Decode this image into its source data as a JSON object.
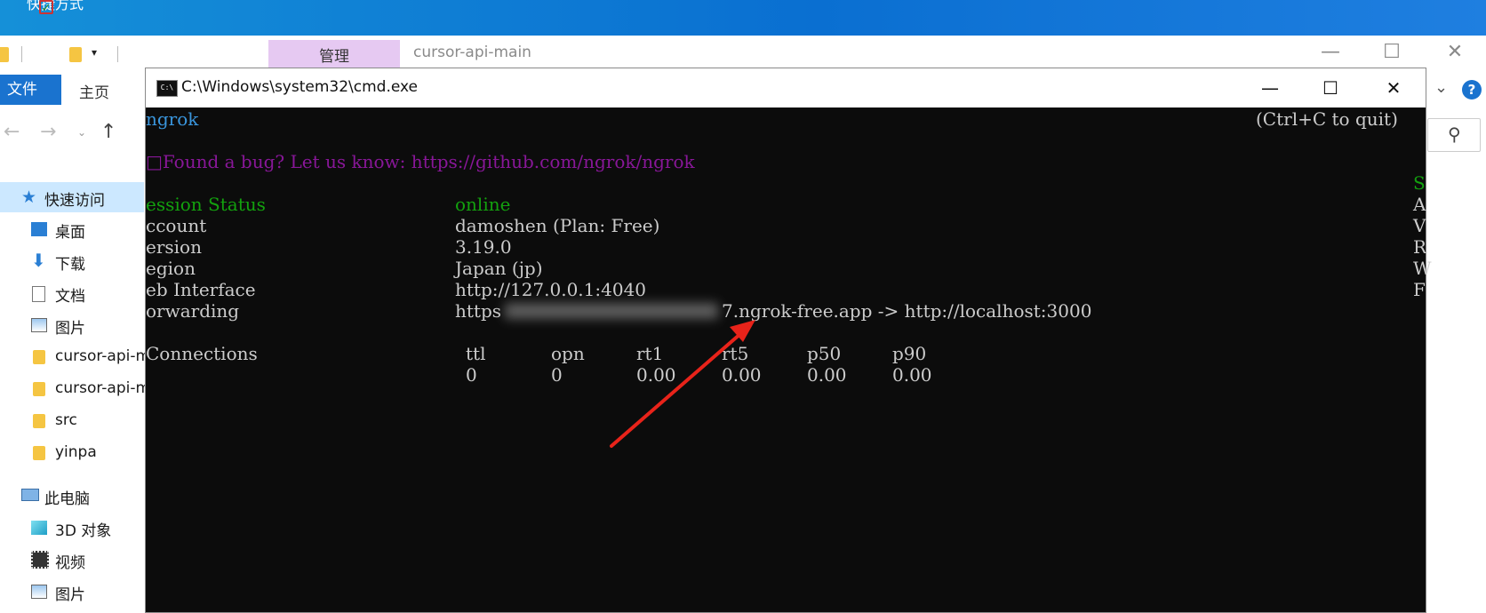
{
  "desktop": {
    "shortcut_label": "快捷方式"
  },
  "explorer": {
    "manage_tab": "管理",
    "title": "cursor-api-main",
    "file_tab": "文件",
    "home_tab": "主页",
    "sidebar": [
      {
        "label": "快速访问",
        "icon": "star-icon"
      },
      {
        "label": "桌面",
        "icon": "desktop-icon"
      },
      {
        "label": "下载",
        "icon": "download-icon"
      },
      {
        "label": "文档",
        "icon": "document-icon"
      },
      {
        "label": "图片",
        "icon": "pictures-icon"
      },
      {
        "label": "cursor-api-main",
        "icon": "folder-icon"
      },
      {
        "label": "cursor-api-main",
        "icon": "folder-icon"
      },
      {
        "label": "src",
        "icon": "folder-icon"
      },
      {
        "label": "yinpa",
        "icon": "folder-icon"
      },
      {
        "label": "此电脑",
        "icon": "computer-icon"
      },
      {
        "label": "3D 对象",
        "icon": "cube-icon"
      },
      {
        "label": "视频",
        "icon": "video-icon"
      },
      {
        "label": "图片",
        "icon": "pictures-icon"
      }
    ]
  },
  "cmd": {
    "title": "C:\\Windows\\system32\\cmd.exe",
    "ngrok": "ngrok",
    "quit_hint": "(Ctrl+C to quit)",
    "bug_line": "□Found a bug? Let us know: https://github.com/ngrok/ngrok",
    "status": {
      "session_label": "ession Status",
      "session_value": "online",
      "account_label": "ccount",
      "account_value": "damoshen (Plan: Free)",
      "version_label": "ersion",
      "version_value": "3.19.0",
      "region_label": "egion",
      "region_value": "Japan (jp)",
      "web_label": "eb Interface",
      "web_value": "http://127.0.0.1:4040",
      "forwarding_label": "orwarding",
      "forwarding_prefix": "https",
      "forwarding_suffix": "7.ngrok-free.app -> http://localhost:3000"
    },
    "connections": {
      "label": "Connections",
      "headers": [
        "ttl",
        "opn",
        "rt1",
        "rt5",
        "p50",
        "p90"
      ],
      "values": [
        "0",
        "0",
        "0.00",
        "0.00",
        "0.00",
        "0.00"
      ]
    },
    "right_column": [
      "S",
      "A",
      "V",
      "R",
      "W",
      "F"
    ]
  },
  "colors": {
    "terminal_bg": "#0c0c0c",
    "terminal_text": "#cccccc",
    "online_green": "#13a10e",
    "bug_purple": "#881798",
    "ngrok_cyan": "#3a96dd",
    "arrow_red": "#e8231a",
    "file_tab_blue": "#1a73cf"
  }
}
